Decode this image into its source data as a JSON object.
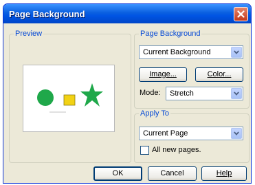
{
  "window": {
    "title": "Page Background"
  },
  "preview": {
    "legend": "Preview"
  },
  "page_background": {
    "legend": "Page Background",
    "background_select": "Current Background",
    "image_button": "Image...",
    "color_button": "Color...",
    "mode_label": "Mode:",
    "mode_select": "Stretch"
  },
  "apply_to": {
    "legend": "Apply To",
    "page_select": "Current Page",
    "all_new_pages_label": "All new pages.",
    "all_new_pages_checked": false
  },
  "buttons": {
    "ok": "OK",
    "cancel": "Cancel",
    "help": "Help"
  },
  "colors": {
    "accent": "#0046D5",
    "shape_green": "#1FA84A",
    "shape_yellow": "#F2D214"
  },
  "icons": [
    "close-icon",
    "chevron-down-icon"
  ]
}
